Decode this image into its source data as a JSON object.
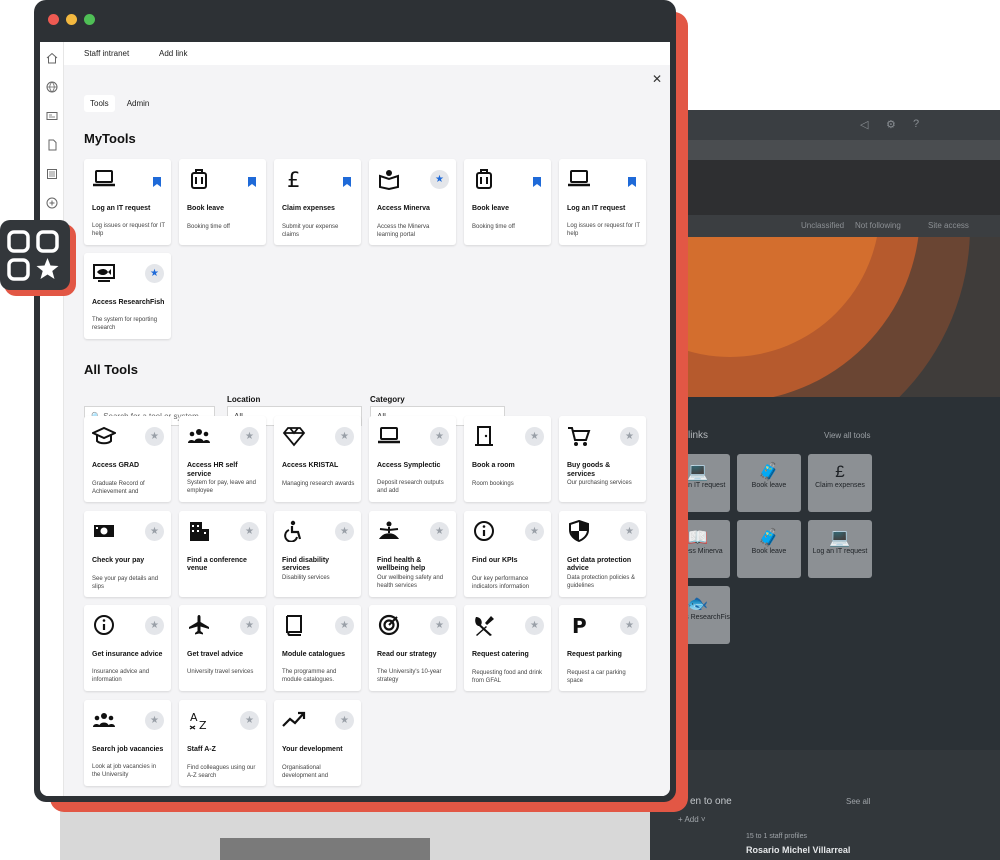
{
  "nav": {
    "intranet": "Staff intranet",
    "add_link": "Add link"
  },
  "tabs": {
    "tools": "Tools",
    "admin": "Admin"
  },
  "my_tools": {
    "heading": "MyTools",
    "items": [
      {
        "icon": "laptop-icon",
        "title": "Log an IT request",
        "desc": "Log issues or request for IT help",
        "marker": "bookmark"
      },
      {
        "icon": "luggage-icon",
        "title": "Book leave",
        "desc": "Booking time off",
        "marker": "bookmark"
      },
      {
        "icon": "pound-icon",
        "title": "Claim expenses",
        "desc": "Submit your expense claims",
        "marker": "bookmark"
      },
      {
        "icon": "map-book-icon",
        "title": "Access Minerva",
        "desc": "Access the Minerva learning portal",
        "marker": "star"
      },
      {
        "icon": "luggage-icon",
        "title": "Book leave",
        "desc": "Booking time off",
        "marker": "bookmark"
      },
      {
        "icon": "laptop-icon",
        "title": "Log an IT request",
        "desc": "Log issues or request for IT help",
        "marker": "bookmark"
      },
      {
        "icon": "fish-screen-icon",
        "title": "Access ResearchFish",
        "desc": "The system for reporting research",
        "marker": "star"
      }
    ]
  },
  "all_tools": {
    "heading": "All Tools",
    "search_placeholder": "Search for a tool or system",
    "location_label": "Location",
    "location_value": "All",
    "category_label": "Category",
    "category_value": "All",
    "items": [
      {
        "icon": "grad-cap-icon",
        "title": "Access GRAD",
        "desc": "Graduate Record of Achievement and"
      },
      {
        "icon": "people-icon",
        "title": "Access HR self service",
        "desc": "System for pay, leave and employee"
      },
      {
        "icon": "diamond-icon",
        "title": "Access KRISTAL",
        "desc": "Managing research awards"
      },
      {
        "icon": "laptop-icon",
        "title": "Access Symplectic",
        "desc": "Deposit research outputs and add"
      },
      {
        "icon": "door-icon",
        "title": "Book a room",
        "desc": "Room bookings"
      },
      {
        "icon": "cart-icon",
        "title": "Buy goods & services",
        "desc": "Our purchasing services"
      },
      {
        "icon": "money-icon",
        "title": "Check your pay",
        "desc": "See your pay details and slips"
      },
      {
        "icon": "building-icon",
        "title": "Find a conference venue",
        "desc": ""
      },
      {
        "icon": "accessibility-icon",
        "title": "Find disability services",
        "desc": "Disability services"
      },
      {
        "icon": "meditation-icon",
        "title": "Find health & wellbeing help",
        "desc": "Our wellbeing safety and health services"
      },
      {
        "icon": "info-icon",
        "title": "Find our KPIs",
        "desc": "Our key performance indicators information"
      },
      {
        "icon": "shield-icon",
        "title": "Get data protection advice",
        "desc": "Data protection policies & guidelines"
      },
      {
        "icon": "info-icon",
        "title": "Get insurance advice",
        "desc": "Insurance advice and information"
      },
      {
        "icon": "plane-icon",
        "title": "Get travel advice",
        "desc": "University travel services"
      },
      {
        "icon": "book-icon",
        "title": "Module catalogues",
        "desc": "The programme and module catalogues."
      },
      {
        "icon": "target-icon",
        "title": "Read our strategy",
        "desc": "The University's 10-year strategy"
      },
      {
        "icon": "cutlery-icon",
        "title": "Request catering",
        "desc": "Requesting food and drink from GFAL"
      },
      {
        "icon": "parking-icon",
        "title": "Request parking",
        "desc": "Request a car parking space"
      },
      {
        "icon": "people-icon",
        "title": "Search job vacancies",
        "desc": "Look at job vacancies in the University"
      },
      {
        "icon": "az-icon",
        "title": "Staff A-Z",
        "desc": "Find colleagues using our A-Z search"
      },
      {
        "icon": "trend-icon",
        "title": "Your development",
        "desc": "Organisational development and"
      }
    ]
  },
  "background": {
    "meta": [
      "Unclassified",
      "Not following",
      "Site access"
    ],
    "links_title": "links",
    "view_all": "View all tools",
    "tiles": [
      "Log an IT request",
      "Book leave",
      "Claim expenses",
      "Access Minerva",
      "Book leave",
      "Log an IT request",
      "Access ResearchFis"
    ],
    "meet": "en to one",
    "see_all": "See all",
    "add": "Add",
    "profiles_count": "15 to 1 staff profiles",
    "profile_name": "Rosario Michel Villarreal"
  },
  "colors": {
    "accent_red": "#e25745",
    "window_dark": "#2d3135",
    "star_blue": "#1f6ad8"
  }
}
